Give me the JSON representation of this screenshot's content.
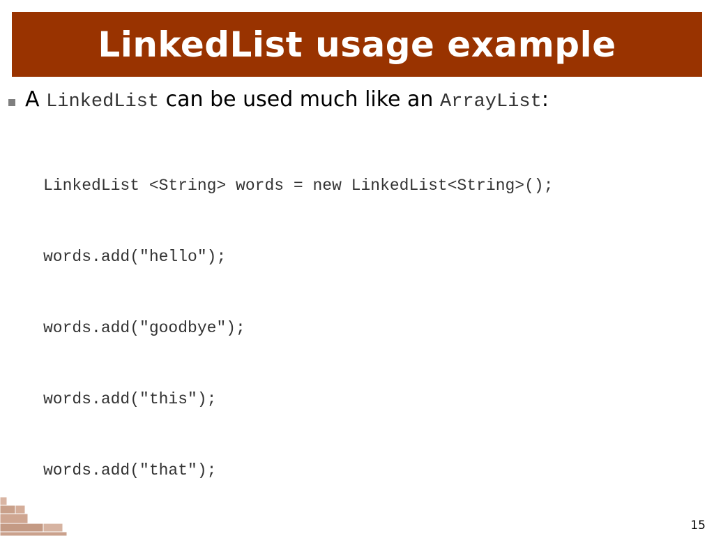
{
  "slide": {
    "title": "LinkedList usage example",
    "page_number": "15"
  },
  "bullet": {
    "prefix": "A",
    "code_1": "LinkedList",
    "middle": "can be used much like an",
    "code_2": "ArrayList",
    "suffix": ":"
  },
  "code_lines": [
    "LinkedList <String> words = new LinkedList<String>();",
    "words.add(\"hello\");",
    "words.add(\"goodbye\");",
    "words.add(\"this\");",
    "words.add(\"that\");"
  ],
  "colors": {
    "title_background": "#993300",
    "title_text": "#ffffff",
    "bullet_square": "#7f7f7f",
    "code_text": "#333333",
    "brick_decoration": "#c9a08a"
  },
  "icons": {
    "bullet": "square-bullet-icon",
    "decoration": "brick-stack-icon"
  }
}
